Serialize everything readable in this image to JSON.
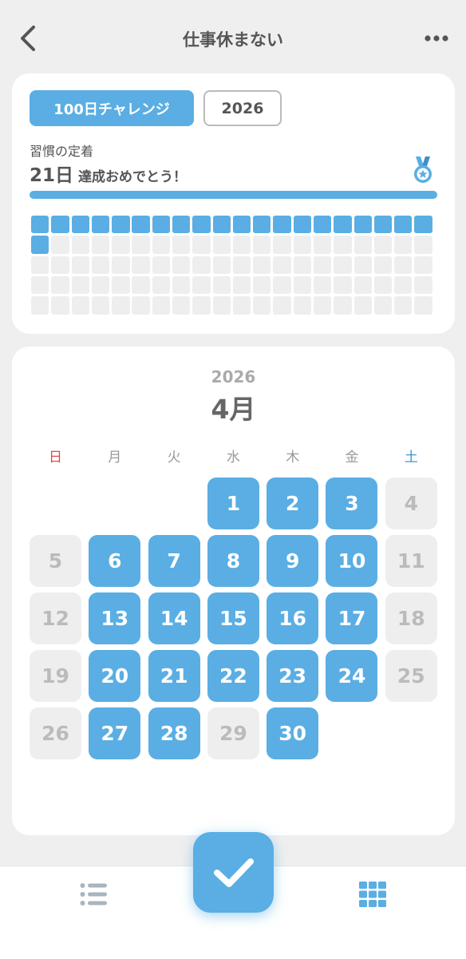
{
  "header": {
    "title": "仕事休まない"
  },
  "challenge": {
    "chip_label": "100日チャレンジ",
    "year_label": "2026",
    "habit_label": "習慣の定着",
    "achieved_days": "21日",
    "achieved_message": "達成おめでとう！",
    "progress_fraction": 1.0,
    "total_cells": 100,
    "completed_cells": 21
  },
  "calendar": {
    "year": "2026",
    "month": "4月",
    "weekdays": [
      "日",
      "月",
      "火",
      "水",
      "木",
      "金",
      "土"
    ],
    "first_weekday_index": 3,
    "days": [
      {
        "label": "1",
        "done": true
      },
      {
        "label": "2",
        "done": true
      },
      {
        "label": "3",
        "done": true
      },
      {
        "label": "4",
        "done": false
      },
      {
        "label": "5",
        "done": false
      },
      {
        "label": "6",
        "done": true
      },
      {
        "label": "7",
        "done": true
      },
      {
        "label": "8",
        "done": true
      },
      {
        "label": "9",
        "done": true
      },
      {
        "label": "10",
        "done": true
      },
      {
        "label": "11",
        "done": false
      },
      {
        "label": "12",
        "done": false
      },
      {
        "label": "13",
        "done": true
      },
      {
        "label": "14",
        "done": true
      },
      {
        "label": "15",
        "done": true
      },
      {
        "label": "16",
        "done": true
      },
      {
        "label": "17",
        "done": true
      },
      {
        "label": "18",
        "done": false
      },
      {
        "label": "19",
        "done": false
      },
      {
        "label": "20",
        "done": true
      },
      {
        "label": "21",
        "done": true
      },
      {
        "label": "22",
        "done": true
      },
      {
        "label": "23",
        "done": true
      },
      {
        "label": "24",
        "done": true
      },
      {
        "label": "25",
        "done": false
      },
      {
        "label": "26",
        "done": false
      },
      {
        "label": "27",
        "done": true
      },
      {
        "label": "28",
        "done": true
      },
      {
        "label": "29",
        "done": false
      },
      {
        "label": "30",
        "done": true
      }
    ]
  },
  "colors": {
    "accent": "#5aaee3",
    "inactive": "#eeeeee",
    "sunday": "#e04848",
    "saturday": "#3a95d4"
  },
  "icons": {
    "back": "chevron-left-icon",
    "more": "more-dots-icon",
    "medal": "medal-icon",
    "list": "list-icon",
    "grid": "grid-icon",
    "check": "check-icon"
  }
}
